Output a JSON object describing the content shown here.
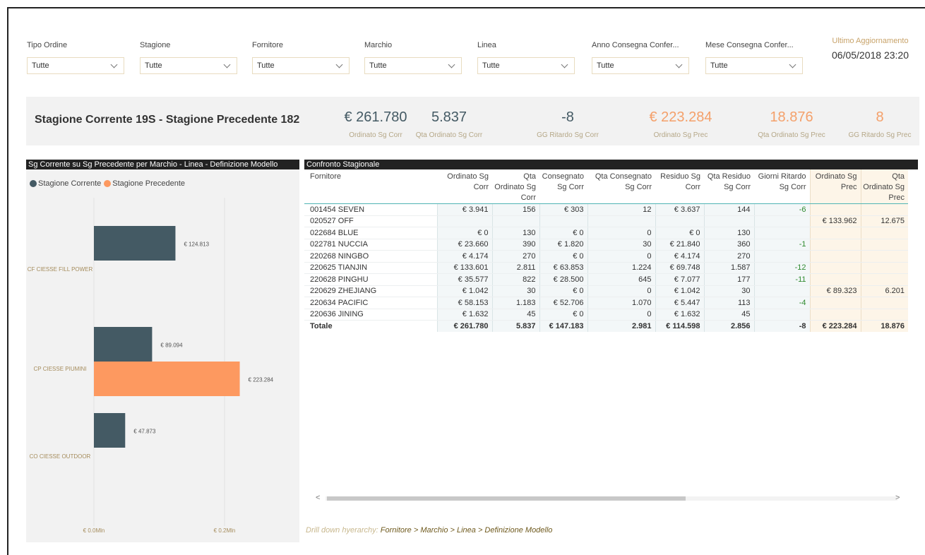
{
  "slicers": [
    {
      "label": "Tipo Ordine",
      "value": "Tutte"
    },
    {
      "label": "Stagione",
      "value": "Tutte"
    },
    {
      "label": "Fornitore",
      "value": "Tutte"
    },
    {
      "label": "Marchio",
      "value": "Tutte"
    },
    {
      "label": "Linea",
      "value": "Tutte"
    },
    {
      "label": "Anno Consegna Confer...",
      "value": "Tutte"
    },
    {
      "label": "Mese Consegna Confer...",
      "value": "Tutte"
    }
  ],
  "updated": {
    "label": "Ultimo Aggiornamento",
    "value": "06/05/2018 23:20"
  },
  "kpi_title": "Stagione Corrente 19S - Stagione Precedente 182",
  "kpis": [
    {
      "value": "€ 261.780",
      "label": "Ordinato Sg Corr"
    },
    {
      "value": "5.837",
      "label": "Qta Ordinato Sg Corr"
    },
    {
      "value": "-8",
      "label": "GG Ritardo Sg Corr"
    },
    {
      "value": "€ 223.284",
      "label": "Ordinato Sg Prec"
    },
    {
      "value": "18.876",
      "label": "Qta Ordinato Sg Prec"
    },
    {
      "value": "8",
      "label": "GG Ritardo Sg Prec"
    }
  ],
  "chart_panel": {
    "title": "Sg Corrente su Sg Precedente per Marchio - Linea - Definizione Modello"
  },
  "table_panel": {
    "title": "Confronto Stagionale"
  },
  "colors": {
    "current": "#445a64",
    "previous": "#fd9960"
  },
  "chart_data": {
    "type": "bar",
    "orientation": "horizontal",
    "title": "Sg Corrente su Sg Precedente per Marchio - Linea - Definizione Modello",
    "categories": [
      "CF CIESSE FILL POWER",
      "CP CIESSE PIUMINI",
      "CO CIESSE OUTDOOR"
    ],
    "series": [
      {
        "name": "Stagione Corrente",
        "values": [
          124813,
          89094,
          47873
        ],
        "labels": [
          "€ 124.813",
          "€ 89.094",
          "€ 47.873"
        ]
      },
      {
        "name": "Stagione Precedente",
        "values": [
          null,
          223284,
          null
        ],
        "labels": [
          "",
          "€ 223.284",
          ""
        ]
      }
    ],
    "xlim": [
      0,
      200000
    ],
    "xticks": [
      0,
      200000
    ],
    "xtick_labels": [
      "€ 0.0Mln",
      "€ 0.2Mln"
    ],
    "grid": true,
    "legend": "top-left"
  },
  "table": {
    "columns": [
      {
        "label": "Fornitore",
        "group": "none"
      },
      {
        "label": "Ordinato Sg Corr",
        "group": "cur"
      },
      {
        "label": "Qta Ordinato Sg Corr",
        "group": "cur"
      },
      {
        "label": "Consegnato Sg Corr",
        "group": "cur"
      },
      {
        "label": "Qta Consegnato Sg Corr",
        "group": "cur"
      },
      {
        "label": "Residuo Sg Corr",
        "group": "cur"
      },
      {
        "label": "Qta Residuo Sg Corr",
        "group": "cur"
      },
      {
        "label": "Giorni Ritardo Sg Corr",
        "group": "cur"
      },
      {
        "label": "Ordinato Sg Prec",
        "group": "prev"
      },
      {
        "label": "Qta Ordinato Sg Prec",
        "group": "prev"
      }
    ],
    "rows": [
      [
        "001454  SEVEN",
        "€ 3.941",
        "156",
        "€ 303",
        "12",
        "€ 3.637",
        "144",
        "-6",
        "",
        ""
      ],
      [
        "020527  OFF",
        "",
        "",
        "",
        "",
        "",
        "",
        "",
        "€ 133.962",
        "12.675"
      ],
      [
        "022684  BLUE",
        "€ 0",
        "130",
        "€ 0",
        "0",
        "€ 0",
        "130",
        "",
        "",
        ""
      ],
      [
        "022781  NUCCIA",
        "€ 23.660",
        "390",
        "€ 1.820",
        "30",
        "€ 21.840",
        "360",
        "-1",
        "",
        ""
      ],
      [
        "220268  NINGBO",
        "€ 4.174",
        "270",
        "€ 0",
        "0",
        "€ 4.174",
        "270",
        "",
        "",
        ""
      ],
      [
        "220625  TIANJIN",
        "€ 133.601",
        "2.811",
        "€ 63.853",
        "1.224",
        "€ 69.748",
        "1.587",
        "-12",
        "",
        ""
      ],
      [
        "220628  PINGHU",
        "€ 35.577",
        "822",
        "€ 28.500",
        "645",
        "€ 7.077",
        "177",
        "-11",
        "",
        ""
      ],
      [
        "220629  ZHEJIANG",
        "€ 1.042",
        "30",
        "€ 0",
        "0",
        "€ 1.042",
        "30",
        "",
        "€ 89.323",
        "6.201"
      ],
      [
        "220634  PACIFIC",
        "€ 58.153",
        "1.183",
        "€ 52.706",
        "1.070",
        "€ 5.447",
        "113",
        "-4",
        "",
        ""
      ],
      [
        "220636  JINING",
        "€ 1.632",
        "45",
        "€ 0",
        "0",
        "€ 1.632",
        "45",
        "",
        "",
        ""
      ]
    ],
    "total": [
      "Totale",
      "€ 261.780",
      "5.837",
      "€ 147.183",
      "2.981",
      "€ 114.598",
      "2.856",
      "-8",
      "€ 223.284",
      "18.876"
    ]
  },
  "scrollbar": {
    "left_arrow": "<",
    "right_arrow": ">"
  },
  "drill": {
    "prefix": "Drill down hyerarchy: ",
    "path": "Fornitore > Marchio > Linea > Definizione Modello"
  }
}
